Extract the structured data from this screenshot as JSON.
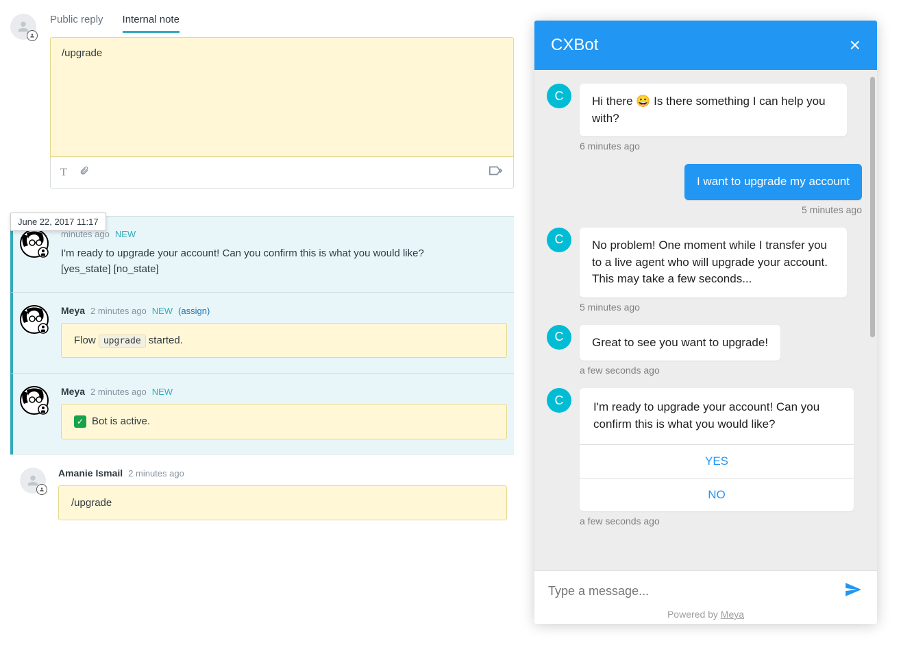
{
  "composer": {
    "tabs": {
      "public_reply": "Public reply",
      "internal_note": "Internal note"
    },
    "note_value": "/upgrade"
  },
  "tooltip": "June 22, 2017 11:17",
  "entries": [
    {
      "author": "",
      "time": "minutes ago",
      "tag": "NEW",
      "text_line1": "I'm ready to upgrade your account! Can you confirm this is what you would like?",
      "text_line2": "[yes_state] [no_state]"
    },
    {
      "author": "Meya",
      "time": "2 minutes ago",
      "tag": "NEW",
      "assign": "(assign)",
      "note_prefix": "Flow ",
      "note_chip": "upgrade",
      "note_suffix": " started."
    },
    {
      "author": "Meya",
      "time": "2 minutes ago",
      "tag": "NEW",
      "note_status": "Bot is active."
    },
    {
      "author": "Amanie Ismail",
      "time": "2 minutes ago",
      "note_simple": "/upgrade"
    }
  ],
  "chat": {
    "title": "CXBot",
    "avatar_letter": "C",
    "messages": [
      {
        "type": "bot",
        "text": "Hi there 😀 Is there something I can help you with?",
        "time": "6 minutes ago"
      },
      {
        "type": "user",
        "text": "I want to upgrade my account",
        "time": "5 minutes ago"
      },
      {
        "type": "bot",
        "text": "No problem! One moment while I transfer you to a live agent who will upgrade your account. This may take a few seconds...",
        "time": "5 minutes ago"
      },
      {
        "type": "bot",
        "text": "Great to see you want to upgrade!",
        "time": "a few seconds ago"
      },
      {
        "type": "card",
        "text": "I'm ready to upgrade your account! Can you confirm this is what you would like?",
        "btn1": "YES",
        "btn2": "NO",
        "time": "a few seconds ago"
      }
    ],
    "input_placeholder": "Type a message...",
    "powered_prefix": "Powered by ",
    "powered_link": "Meya"
  }
}
